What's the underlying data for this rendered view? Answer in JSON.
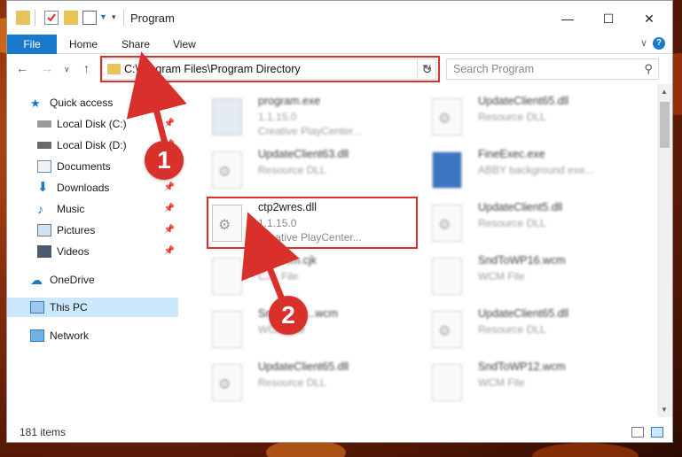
{
  "window": {
    "title": "Program"
  },
  "ribbon": {
    "file": "File",
    "home": "Home",
    "share": "Share",
    "view": "View",
    "help": "?"
  },
  "address": {
    "path": "C:\\Program Files\\Program Directory"
  },
  "search": {
    "placeholder": "Search Program"
  },
  "sidebar": {
    "items": [
      {
        "label": "Quick access",
        "icon": "star-icon"
      },
      {
        "label": "Local Disk (C:)",
        "icon": "drive-icon"
      },
      {
        "label": "Local Disk (D:)",
        "icon": "drive-icon"
      },
      {
        "label": "Documents",
        "icon": "documents-icon"
      },
      {
        "label": "Downloads",
        "icon": "download-icon"
      },
      {
        "label": "Music",
        "icon": "music-icon"
      },
      {
        "label": "Pictures",
        "icon": "pictures-icon"
      },
      {
        "label": "Videos",
        "icon": "videos-icon"
      },
      {
        "label": "OneDrive",
        "icon": "cloud-icon"
      },
      {
        "label": "This PC",
        "icon": "computer-icon"
      },
      {
        "label": "Network",
        "icon": "network-icon"
      }
    ]
  },
  "files": [
    {
      "name": "program.exe",
      "line2": "1.1.15.0",
      "line3": "Creative PlayCenter..."
    },
    {
      "name": "UpdateClient65.dll",
      "line2": "Resource DLL",
      "line3": ""
    },
    {
      "name": "UpdateClient63.dll",
      "line2": "Resource DLL",
      "line3": ""
    },
    {
      "name": "FineExec.exe",
      "line2": "ABBY background exe...",
      "line3": ""
    },
    {
      "name": "ctp2wres.dll",
      "line2": "1.1.15.0",
      "line3": "Creative PlayCenter..."
    },
    {
      "name": "UpdateClient5.dll",
      "line2": "Resource DLL",
      "line3": ""
    },
    {
      "name": "Flexcom.cjk",
      "line2": "CJK File",
      "line3": ""
    },
    {
      "name": "SndToWP16.wcm",
      "line2": "WCM File",
      "line3": ""
    },
    {
      "name": "SndToWP...wcm",
      "line2": "WCM File",
      "line3": ""
    },
    {
      "name": "UpdateClient65.dll",
      "line2": "Resource DLL",
      "line3": ""
    },
    {
      "name": "UpdateClient65.dll",
      "line2": "Resource DLL",
      "line3": ""
    },
    {
      "name": "SndToWP12.wcm",
      "line2": "WCM File",
      "line3": ""
    }
  ],
  "status": {
    "count": "181 items"
  },
  "annotations": {
    "step1": "1",
    "step2": "2",
    "color": "#d9302b"
  }
}
